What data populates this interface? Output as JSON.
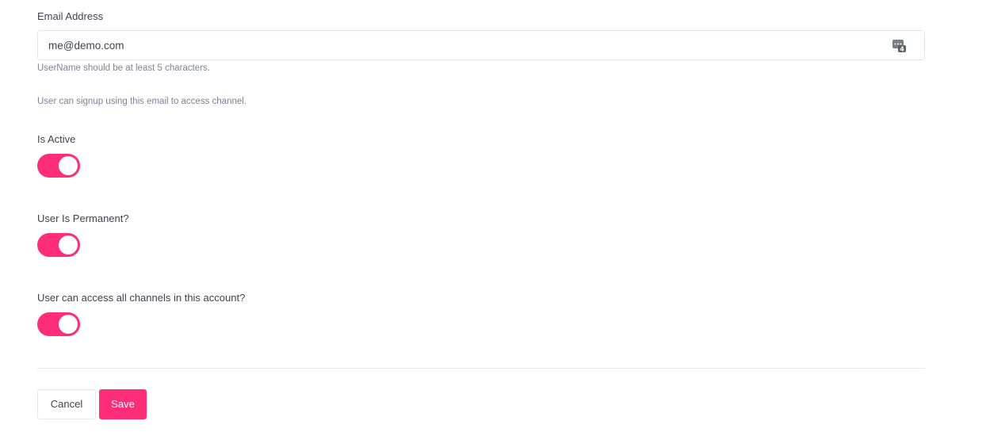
{
  "email": {
    "label": "Email Address",
    "value": "me@demo.com",
    "icon": "password-manager-icon",
    "badge": "4",
    "help_username": "UserName should be at least 5 characters.",
    "help_signup": "User can signup using this email to access channel."
  },
  "is_active": {
    "label": "Is Active",
    "checked": true
  },
  "is_permanent": {
    "label": "User Is Permanent?",
    "checked": true
  },
  "all_channels": {
    "label": "User can access all channels in this account?",
    "checked": true
  },
  "actions": {
    "cancel_label": "Cancel",
    "save_label": "Save"
  },
  "colors": {
    "accent": "#ff2d78",
    "border": "#e4e6ef",
    "text": "#3f4254",
    "muted": "#7e8299"
  }
}
